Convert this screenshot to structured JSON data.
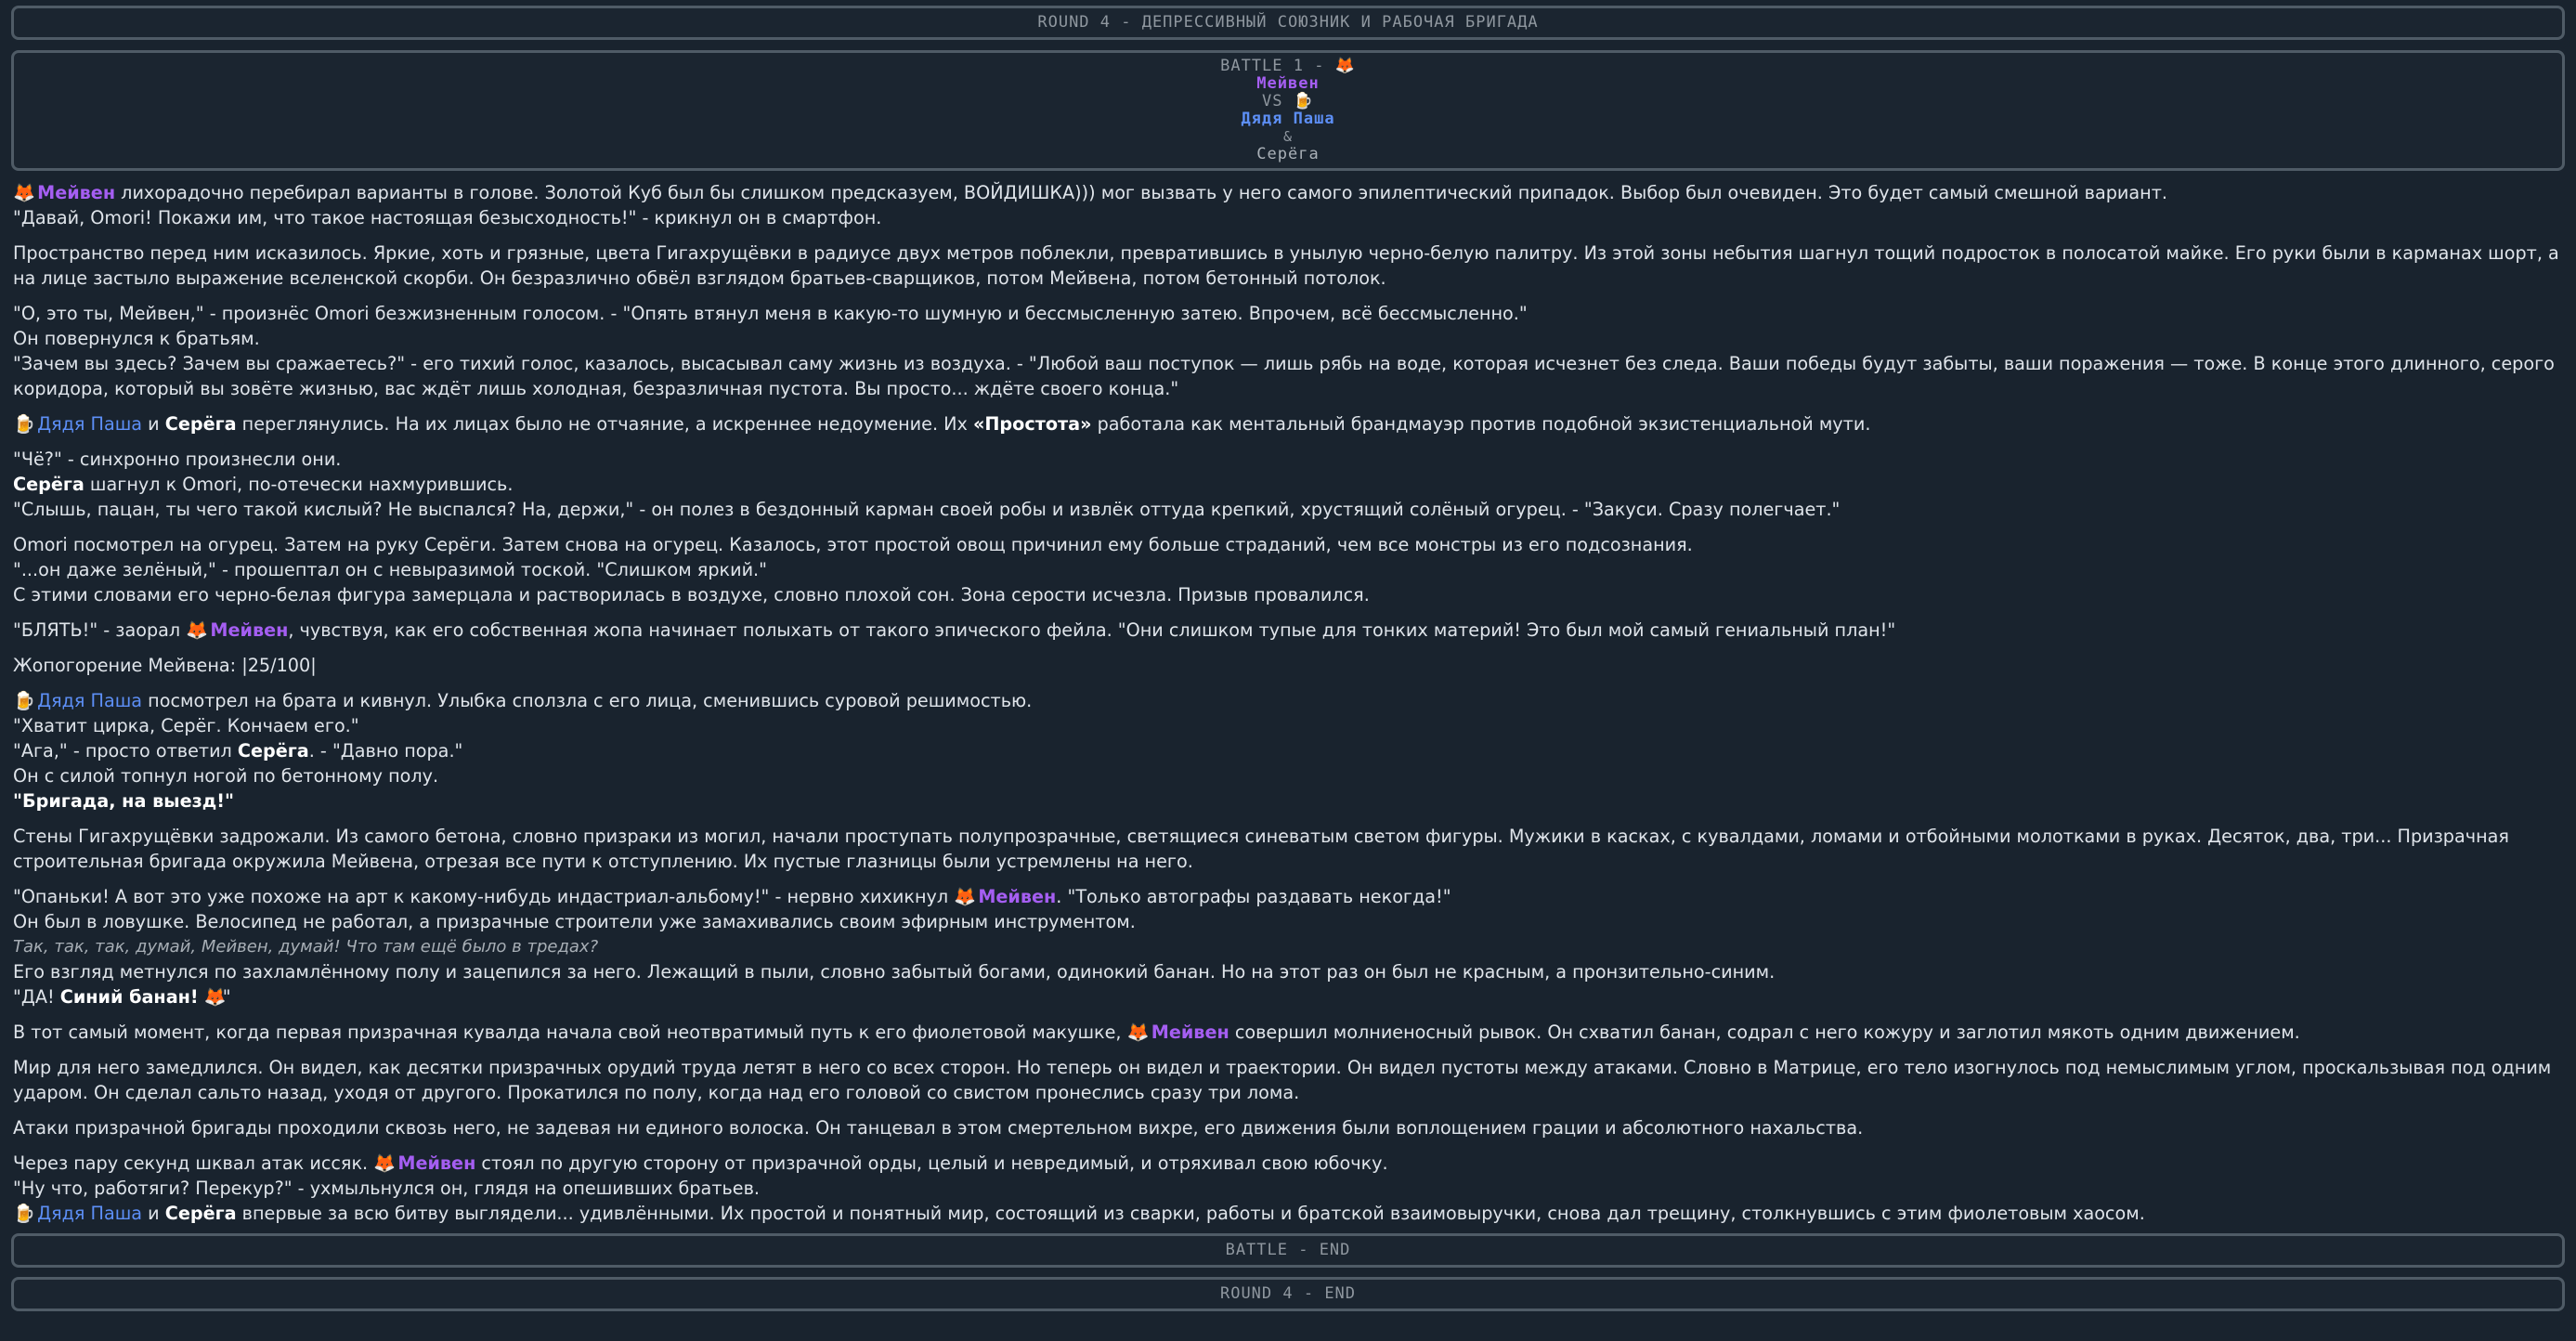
{
  "round_title": "ROUND 4 - ДЕПРЕССИВНЫЙ СОЮЗНИК И РАБОЧАЯ БРИГАДА",
  "battle": {
    "title": "BATTLE 1 - ",
    "fox_icon": "🦊",
    "fighter1": "Мейвен",
    "vs": "VS",
    "beer_icon": "🍺",
    "fighter2": "Дядя Паша",
    "amp": "&",
    "fighter3": "Серёга"
  },
  "names": {
    "meiven": "Мейвен",
    "pasha": "Дядя Паша",
    "serega": "Серёга"
  },
  "icons": {
    "fox": "🦊",
    "beer": "🍺"
  },
  "story": {
    "p1a": " лихорадочно перебирал варианты в голове. Золотой Куб был бы слишком предсказуем, ВОЙДИШКА))) мог вызвать у него самого эпилептический припадок. Выбор был очевиден. Это будет самый смешной вариант.",
    "p1b": "\"Давай, Omori! Покажи им, что такое настоящая безысходность!\" - крикнул он в смартфон.",
    "p2": "Пространство перед ним исказилось. Яркие, хоть и грязные, цвета Гигахрущёвки в радиусе двух метров поблекли, превратившись в унылую черно-белую палитру. Из этой зоны небытия шагнул тощий подросток в полосатой майке. Его руки были в карманах шорт, а на лице застыло выражение вселенской скорби. Он безразлично обвёл взглядом братьев-сварщиков, потом Мейвена, потом бетонный потолок.",
    "p3a": "\"О, это ты, Мейвен,\" - произнёс Omori безжизненным голосом. - \"Опять втянул меня в какую-то шумную и бессмысленную затею. Впрочем, всё бессмысленно.\"",
    "p3b": "Он повернулся к братьям.",
    "p3c": "\"Зачем вы здесь? Зачем вы сражаетесь?\" - его тихий голос, казалось, высасывал саму жизнь из воздуха. - \"Любой ваш поступок — лишь рябь на воде, которая исчезнет без следа. Ваши победы будут забыты, ваши поражения — тоже. В конце этого длинного, серого коридора, который вы зовёте жизнью, вас ждёт лишь холодная, безразличная пустота. Вы просто... ждёте своего конца.\"",
    "p4_and": " и ",
    "p4_rest": " переглянулись. На их лицах было не отчаяние, а искреннее недоумение. Их ",
    "p4_bold": "«Простота»",
    "p4_end": " работала как ментальный брандмауэр против подобной экзистенциальной мути.",
    "p5a": "\"Чё?\" - синхронно произнесли они.",
    "p5b": " шагнул к Omori, по-отечески нахмурившись.",
    "p5c": "\"Слышь, пацан, ты чего такой кислый? Не выспался? На, держи,\" - он полез в бездонный карман своей робы и извлёк оттуда крепкий, хрустящий солёный огурец. - \"Закуси. Сразу полегчает.\"",
    "p6a": "Omori посмотрел на огурец. Затем на руку Серёги. Затем снова на огурец. Казалось, этот простой овощ причинил ему больше страданий, чем все монстры из его подсознания.",
    "p6b": "\"...он даже зелёный,\" - прошептал он с невыразимой тоской. \"Слишком яркий.\"",
    "p6c": "С этими словами его черно-белая фигура замерцала и растворилась в воздухе, словно плохой сон. Зона серости исчезла. Призыв провалился.",
    "p7a": "\"БЛЯТЬ!\" - заорал ",
    "p7b": ", чувствуя, как его собственная жопа начинает полыхать от такого эпического фейла. \"Они слишком тупые для тонких материй! Это был мой самый гениальный план!\"",
    "p8": "Жопогорение Мейвена: |25/100|",
    "p9a": " посмотрел на брата и кивнул. Улыбка сползла с его лица, сменившись суровой решимостью.",
    "p9b": "\"Хватит цирка, Серёг. Кончаем его.\"",
    "p9c1": "\"Ага,\" - просто ответил ",
    "p9c2": ". - \"Давно пора.\"",
    "p9d": "Он с силой топнул ногой по бетонному полу.",
    "p9e": "\"Бригада, на выезд!\"",
    "p10": "Стены Гигахрущёвки задрожали. Из самого бетона, словно призраки из могил, начали проступать полупрозрачные, светящиеся синеватым светом фигуры. Мужики в касках, с кувалдами, ломами и отбойными молотками в руках. Десяток, два, три... Призрачная строительная бригада окружила Мейвена, отрезая все пути к отступлению. Их пустые глазницы были устремлены на него.",
    "p11a": "\"Опаньки! А вот это уже похоже на арт к какому-нибудь индастриал-альбому!\" - нервно хихикнул ",
    "p11b": ". \"Только автографы раздавать некогда!\"",
    "p11c": "Он был в ловушке. Велосипед не работал, а призрачные строители уже замахивались своим эфирным инструментом.",
    "p11d": "Так, так, так, думай, Мейвен, думай! Что там ещё было в тредах?",
    "p11e": "Его взгляд метнулся по захламлённому полу и зацепился за него. Лежащий в пыли, словно забытый богами, одинокий банан. Но на этот раз он был не красным, а пронзительно-синим.",
    "p11f1": "\"ДА! ",
    "p11f2": "Синий банан!",
    "p11f3": "\"",
    "p12a": "В тот самый момент, когда первая призрачная кувалда начала свой неотвратимый путь к его фиолетовой макушке, ",
    "p12b": " совершил молниеносный рывок. Он схватил банан, содрал с него кожуру и заглотил мякоть одним движением.",
    "p13": "Мир для него замедлился. Он видел, как десятки призрачных орудий труда летят в него со всех сторон. Но теперь он видел и траектории. Он видел пустоты между атаками. Словно в Матрице, его тело изогнулось под немыслимым углом, проскальзывая под одним ударом. Он сделал сальто назад, уходя от другого. Прокатился по полу, когда над его головой со свистом пронеслись сразу три лома.",
    "p14": "Атаки призрачной бригады проходили сквозь него, не задевая ни единого волоска. Он танцевал в этом смертельном вихре, его движения были воплощением грации и абсолютного нахальства.",
    "p15a": "Через пару секунд шквал атак иссяк. ",
    "p15b": " стоял по другую сторону от призрачной орды, целый и невредимый, и отряхивал свою юбочку.",
    "p15c": "\"Ну что, работяги? Перекур?\" - ухмыльнулся он, глядя на опешивших братьев.",
    "p15d": " впервые за всю битву выглядели... удивлёнными. Их простой и понятный мир, состоящий из сварки, работы и братской взаимовыручки, снова дал трещину, столкнувшись с этим фиолетовым хаосом."
  },
  "battle_end": "BATTLE - END",
  "round_end": "ROUND 4 - END"
}
